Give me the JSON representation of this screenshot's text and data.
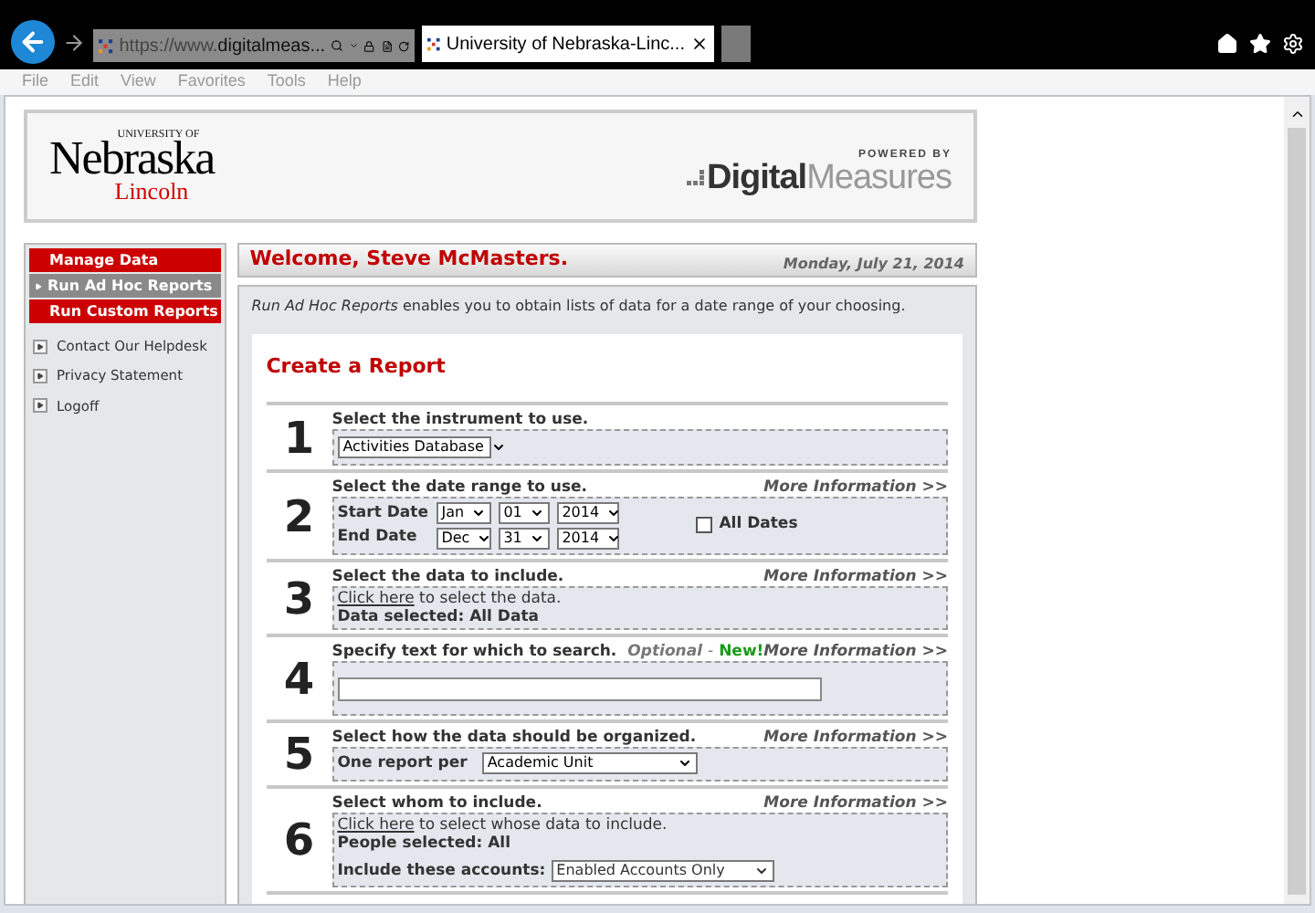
{
  "browser": {
    "address": {
      "prefix": "https://www.",
      "host": "digitalmeas..."
    },
    "tabs": [
      {
        "label": "University of Nebraska-Linc...",
        "selected": true
      }
    ],
    "menu": [
      "File",
      "Edit",
      "View",
      "Favorites",
      "Tools",
      "Help"
    ]
  },
  "header": {
    "university": {
      "top": "UNIVERSITY OF",
      "name": "Nebraska",
      "campus": "Lincoln"
    },
    "vendor": {
      "powered": "POWERED BY",
      "bold": "Digital",
      "light": "Measures"
    }
  },
  "sidebar": {
    "nav": [
      {
        "label": "Manage Data",
        "selected": false
      },
      {
        "label": "Run Ad Hoc Reports",
        "selected": true
      },
      {
        "label": "Run Custom Reports",
        "selected": false
      }
    ],
    "links": [
      "Contact Our Helpdesk",
      "Privacy Statement",
      "Logoff"
    ]
  },
  "welcome": "Welcome, Steve McMasters.",
  "date": "Monday, July 21, 2014",
  "intro": "*Run Ad Hoc Reports* enables you to obtain lists of data for a date range of your choosing.",
  "report": {
    "title": "Create a Report",
    "steps": [
      {
        "number": "1",
        "kind": "instrument",
        "label": "Select the instrument to use.",
        "select": "Activities Database"
      },
      {
        "number": "2",
        "kind": "dates",
        "label": "Select the date range to use.",
        "more": "More Information >>",
        "start_label": "Start Date",
        "end_label": "End Date",
        "start": [
          "Jan",
          "01",
          "2014"
        ],
        "end": [
          "Dec",
          "31",
          "2014"
        ],
        "all_dates": {
          "label": "All Dates",
          "checked": false
        }
      },
      {
        "number": "3",
        "kind": "data",
        "label": "Select the data to include.",
        "more": "More Information >>",
        "link": "Click here",
        "link_rest": " to select the data.",
        "selected": "Data selected: All Data"
      },
      {
        "number": "4",
        "kind": "search",
        "label": "Specify text for which to search.",
        "optional": "Optional",
        "dash": "-",
        "new": "New!",
        "more": "More Information >>"
      },
      {
        "number": "5",
        "kind": "organize",
        "label": "Select how the data should be organized.",
        "more": "More Information >>",
        "field_label": "One report per",
        "select": "Academic Unit"
      },
      {
        "number": "6",
        "kind": "people",
        "label": "Select whom to include.",
        "more": "More Information >>",
        "link": "Click here",
        "link_rest": " to select whose data to include.",
        "selected": "People selected: All",
        "field_label": "Include these accounts:",
        "select": "Enabled Accounts Only"
      }
    ]
  }
}
